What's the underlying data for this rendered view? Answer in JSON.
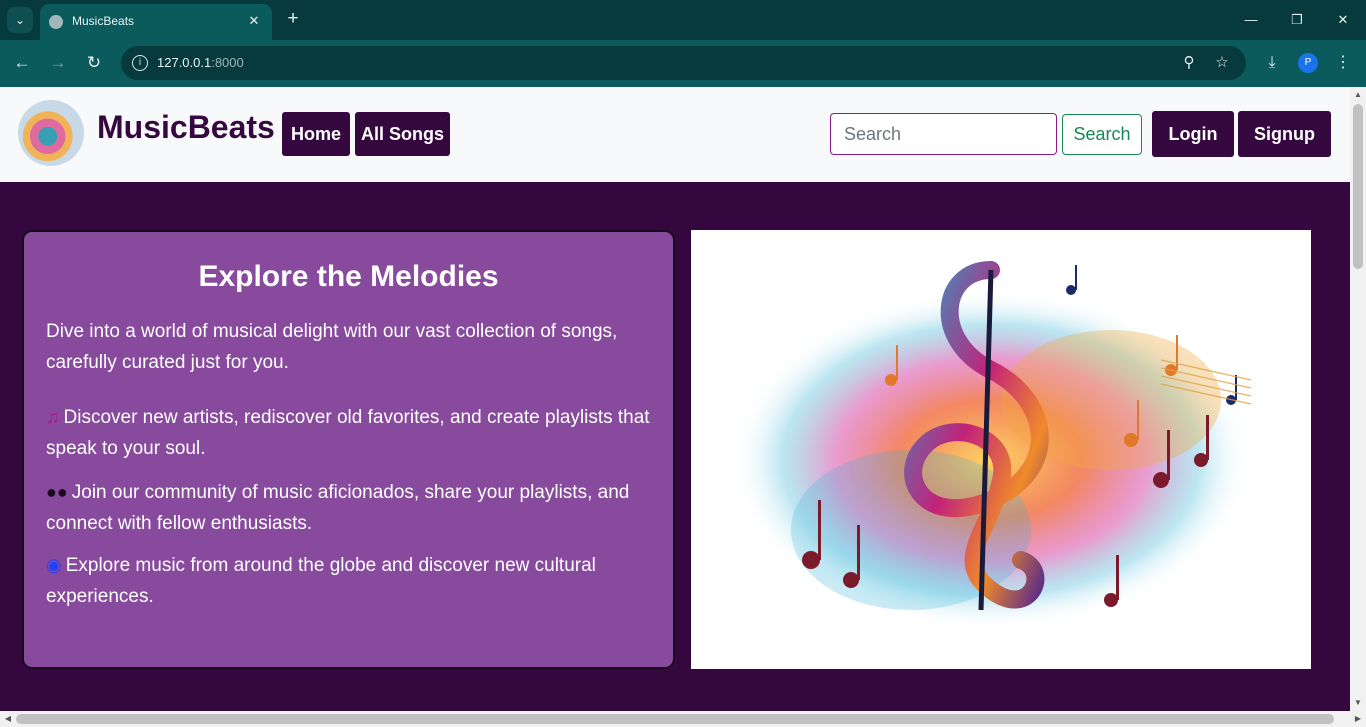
{
  "browser": {
    "tab_title": "MusicBeats",
    "url_host": "127.0.0.1",
    "url_port": ":8000",
    "profile_initial": "P"
  },
  "navbar": {
    "brand": "MusicBeats",
    "links": [
      "Home",
      "All Songs"
    ],
    "search_placeholder": "Search",
    "search_button": "Search",
    "login": "Login",
    "signup": "Signup"
  },
  "hero": {
    "title": "Explore the Melodies",
    "intro": "Dive into a world of musical delight with our vast collection of songs, carefully curated just for you.",
    "points": [
      {
        "icon": "music-note-icon",
        "text": "Discover new artists, rediscover old favorites, and create playlists that speak to your soul."
      },
      {
        "icon": "users-icon",
        "text": "Join our community of music aficionados, share your playlists, and connect with fellow enthusiasts."
      },
      {
        "icon": "globe-icon",
        "text": "Explore music from around the globe and discover new cultural experiences."
      }
    ]
  },
  "colors": {
    "brand_purple": "#35083f",
    "card_purple": "#874a9c",
    "search_green": "#198754"
  }
}
